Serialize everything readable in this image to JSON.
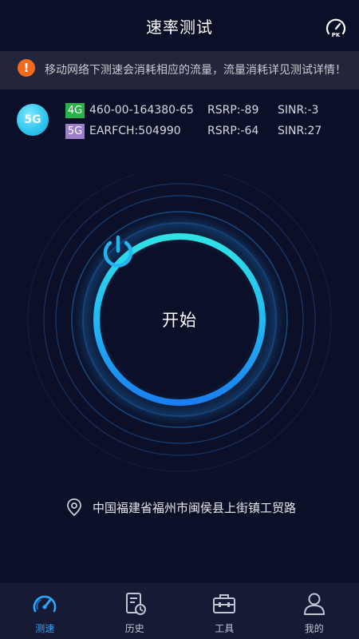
{
  "header": {
    "title": "速率测试",
    "pk_icon": "speed-pk-icon"
  },
  "notice": {
    "icon": "warning-icon",
    "text": "移动网络下测速会消耗相应的流量，流量消耗详见测试详情！",
    "color": "#f26b1d"
  },
  "network": {
    "badge": "5G",
    "rows": [
      {
        "tag": "4G",
        "id": "460-00-164380-65",
        "rsrp": "RSRP:-89",
        "sinr": "SINR:-3",
        "tag_color": "#26b34a"
      },
      {
        "tag": "5G",
        "id": "EARFCH:504990",
        "rsrp": "RSRP:-64",
        "sinr": "SINR:27",
        "tag_color": "#9b7fc8"
      }
    ]
  },
  "gauge": {
    "start_label": "开始",
    "icon": "power-icon",
    "accent": "#22c9f0"
  },
  "location": {
    "icon": "location-pin-icon",
    "text": "中国福建省福州市闽侯县上街镇工贸路"
  },
  "nav": {
    "items": [
      {
        "label": "测速",
        "icon": "speedometer-icon",
        "active": true
      },
      {
        "label": "历史",
        "icon": "history-icon",
        "active": false
      },
      {
        "label": "工具",
        "icon": "toolbox-icon",
        "active": false
      },
      {
        "label": "我的",
        "icon": "user-icon",
        "active": false
      }
    ],
    "active_color": "#2aa8ff"
  }
}
